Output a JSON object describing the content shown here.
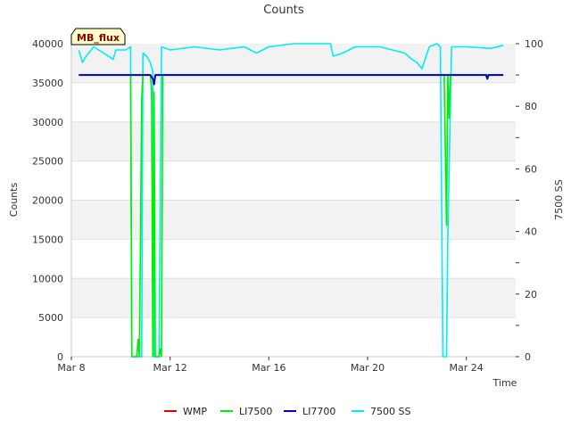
{
  "chart_data": {
    "type": "line",
    "title": "Counts",
    "xlabel": "Time",
    "ylabel": "Counts",
    "y2label": "7500 SS",
    "badge": "MB_flux",
    "x_unit": "days (Mar 2024)",
    "xlim": [
      "Mar 8",
      "Mar 26"
    ],
    "ylim": [
      0,
      40000
    ],
    "y2lim": [
      0,
      100
    ],
    "x_ticks": [
      "Mar 8",
      "Mar 12",
      "Mar 16",
      "Mar 20",
      "Mar 24"
    ],
    "y_ticks": [
      "0",
      "5000",
      "10000",
      "15000",
      "20000",
      "25000",
      "30000",
      "35000",
      "40000"
    ],
    "y2_ticks": [
      "0",
      "20",
      "40",
      "60",
      "80",
      "100"
    ],
    "grid": "horizontal bands",
    "legend_position": "bottom",
    "series": [
      {
        "name": "WMP",
        "color": "#dd0000",
        "axis": "left",
        "points": []
      },
      {
        "name": "LI7500",
        "color": "#00ee00",
        "axis": "left",
        "points": [
          [
            8.3,
            36000
          ],
          [
            10.4,
            36000
          ],
          [
            10.45,
            0
          ],
          [
            10.65,
            0
          ],
          [
            10.7,
            2200
          ],
          [
            10.75,
            0
          ],
          [
            10.8,
            15000
          ],
          [
            10.85,
            33000
          ],
          [
            10.9,
            36000
          ],
          [
            11.2,
            36000
          ],
          [
            11.25,
            34000
          ],
          [
            11.3,
            0
          ],
          [
            11.35,
            33800
          ],
          [
            11.4,
            0
          ],
          [
            11.55,
            0
          ],
          [
            11.6,
            1000
          ],
          [
            11.65,
            0
          ],
          [
            11.7,
            36000
          ],
          [
            23.1,
            36000
          ],
          [
            23.2,
            16800
          ],
          [
            23.25,
            36000
          ],
          [
            23.3,
            30500
          ],
          [
            23.35,
            36000
          ],
          [
            25.5,
            36000
          ]
        ]
      },
      {
        "name": "LI7700",
        "color": "#0000cc",
        "axis": "left",
        "points": [
          [
            8.3,
            36000
          ],
          [
            11.2,
            36000
          ],
          [
            11.3,
            35500
          ],
          [
            11.35,
            34800
          ],
          [
            11.4,
            36000
          ],
          [
            24.8,
            36000
          ],
          [
            24.85,
            35500
          ],
          [
            24.9,
            36000
          ],
          [
            25.5,
            36000
          ]
        ]
      },
      {
        "name": "7500 SS",
        "color": "#00eeee",
        "axis": "right",
        "points": [
          [
            8.3,
            98
          ],
          [
            8.45,
            94
          ],
          [
            8.6,
            96
          ],
          [
            8.9,
            99
          ],
          [
            9.3,
            97
          ],
          [
            9.7,
            95
          ],
          [
            9.8,
            98
          ],
          [
            10.2,
            98
          ],
          [
            10.4,
            99
          ],
          [
            10.45,
            0
          ],
          [
            10.85,
            0
          ],
          [
            10.9,
            97
          ],
          [
            11.05,
            96
          ],
          [
            11.2,
            94
          ],
          [
            11.3,
            91
          ],
          [
            11.35,
            0
          ],
          [
            11.55,
            0
          ],
          [
            11.65,
            99
          ],
          [
            12.0,
            98
          ],
          [
            13.0,
            99
          ],
          [
            14.0,
            98
          ],
          [
            15.0,
            99
          ],
          [
            15.5,
            97
          ],
          [
            16.0,
            99
          ],
          [
            17.0,
            100
          ],
          [
            18.5,
            100
          ],
          [
            18.6,
            96
          ],
          [
            19.0,
            97
          ],
          [
            19.5,
            99
          ],
          [
            20.5,
            99
          ],
          [
            21.5,
            97
          ],
          [
            21.8,
            95
          ],
          [
            22.0,
            94
          ],
          [
            22.2,
            92
          ],
          [
            22.5,
            99
          ],
          [
            22.8,
            100
          ],
          [
            22.95,
            99
          ],
          [
            23.05,
            0
          ],
          [
            23.2,
            0
          ],
          [
            23.25,
            38
          ],
          [
            23.4,
            99
          ],
          [
            24.0,
            99
          ],
          [
            25.0,
            98.5
          ],
          [
            25.5,
            99.5
          ]
        ]
      }
    ]
  }
}
